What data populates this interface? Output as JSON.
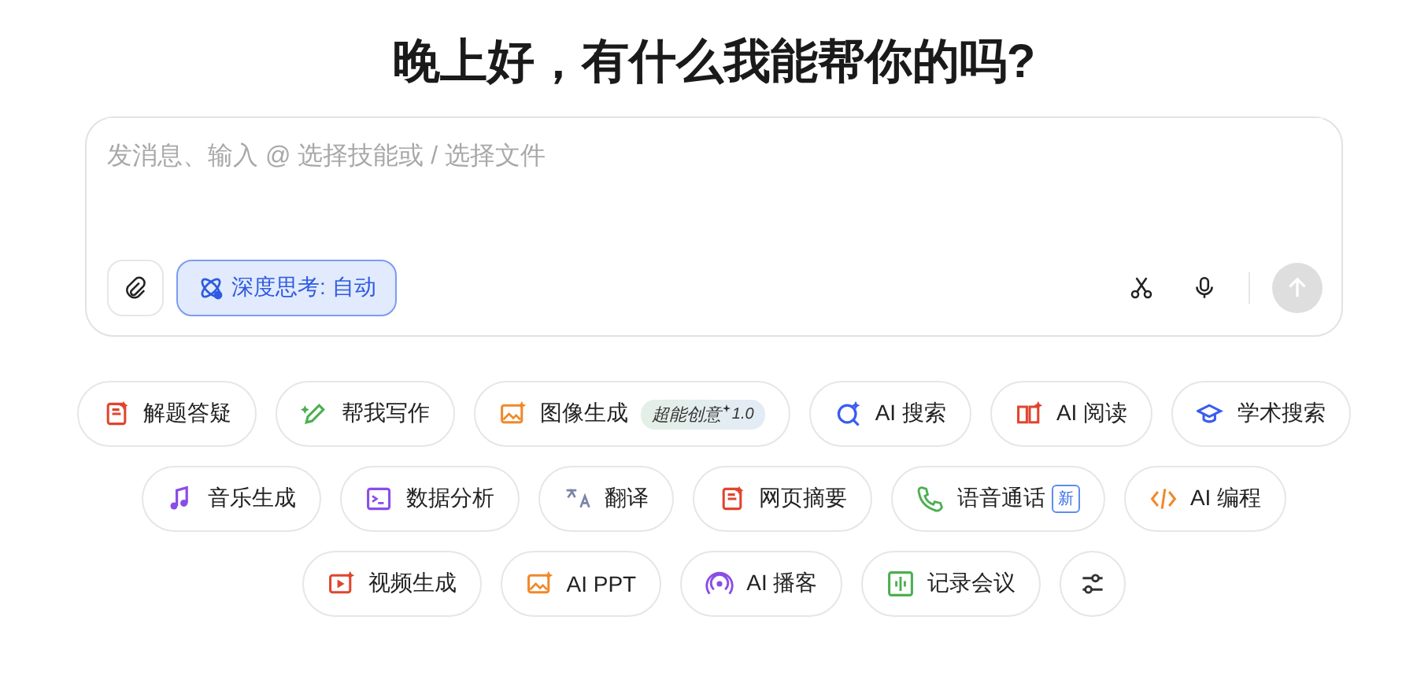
{
  "greeting": "晚上好，有什么我能帮你的吗?",
  "composer": {
    "placeholder": "发消息、输入 @ 选择技能或 / 选择文件",
    "deep_think": {
      "label": "深度思考: 自动",
      "on": true
    }
  },
  "skill_rows": [
    {
      "skills": [
        {
          "label": "解题答疑",
          "kind": "doc",
          "color": "#e0452f"
        },
        {
          "label": "帮我写作",
          "kind": "pen",
          "color": "#4caf50"
        },
        {
          "label": "图像生成",
          "kind": "image",
          "color": "#f0892b",
          "badge": "超能创意",
          "badge_version": "1.0"
        },
        {
          "label": "AI 搜索",
          "kind": "search",
          "color": "#3a5cf0"
        },
        {
          "label": "AI 阅读",
          "kind": "book",
          "color": "#e0452f"
        },
        {
          "label": "学术搜索",
          "kind": "cap",
          "color": "#3a5cf0"
        }
      ]
    },
    {
      "skills": [
        {
          "label": "音乐生成",
          "kind": "music",
          "color": "#8a4de6"
        },
        {
          "label": "数据分析",
          "kind": "terminal",
          "color": "#8a4de6"
        },
        {
          "label": "翻译",
          "kind": "translate",
          "color": "#7a85a8"
        },
        {
          "label": "网页摘要",
          "kind": "doc",
          "color": "#e0452f"
        },
        {
          "label": "语音通话",
          "kind": "phone",
          "color": "#4caf50",
          "tag": "新"
        },
        {
          "label": "AI 编程",
          "kind": "code",
          "color": "#f0892b"
        }
      ]
    },
    {
      "skills": [
        {
          "label": "视频生成",
          "kind": "video",
          "color": "#e0452f"
        },
        {
          "label": "AI PPT",
          "kind": "image",
          "color": "#f0892b"
        },
        {
          "label": "AI 播客",
          "kind": "podcast",
          "color": "#8a4de6"
        },
        {
          "label": "记录会议",
          "kind": "audio",
          "color": "#4caf50"
        },
        {
          "kind": "settings",
          "color": "#333333"
        }
      ]
    }
  ]
}
